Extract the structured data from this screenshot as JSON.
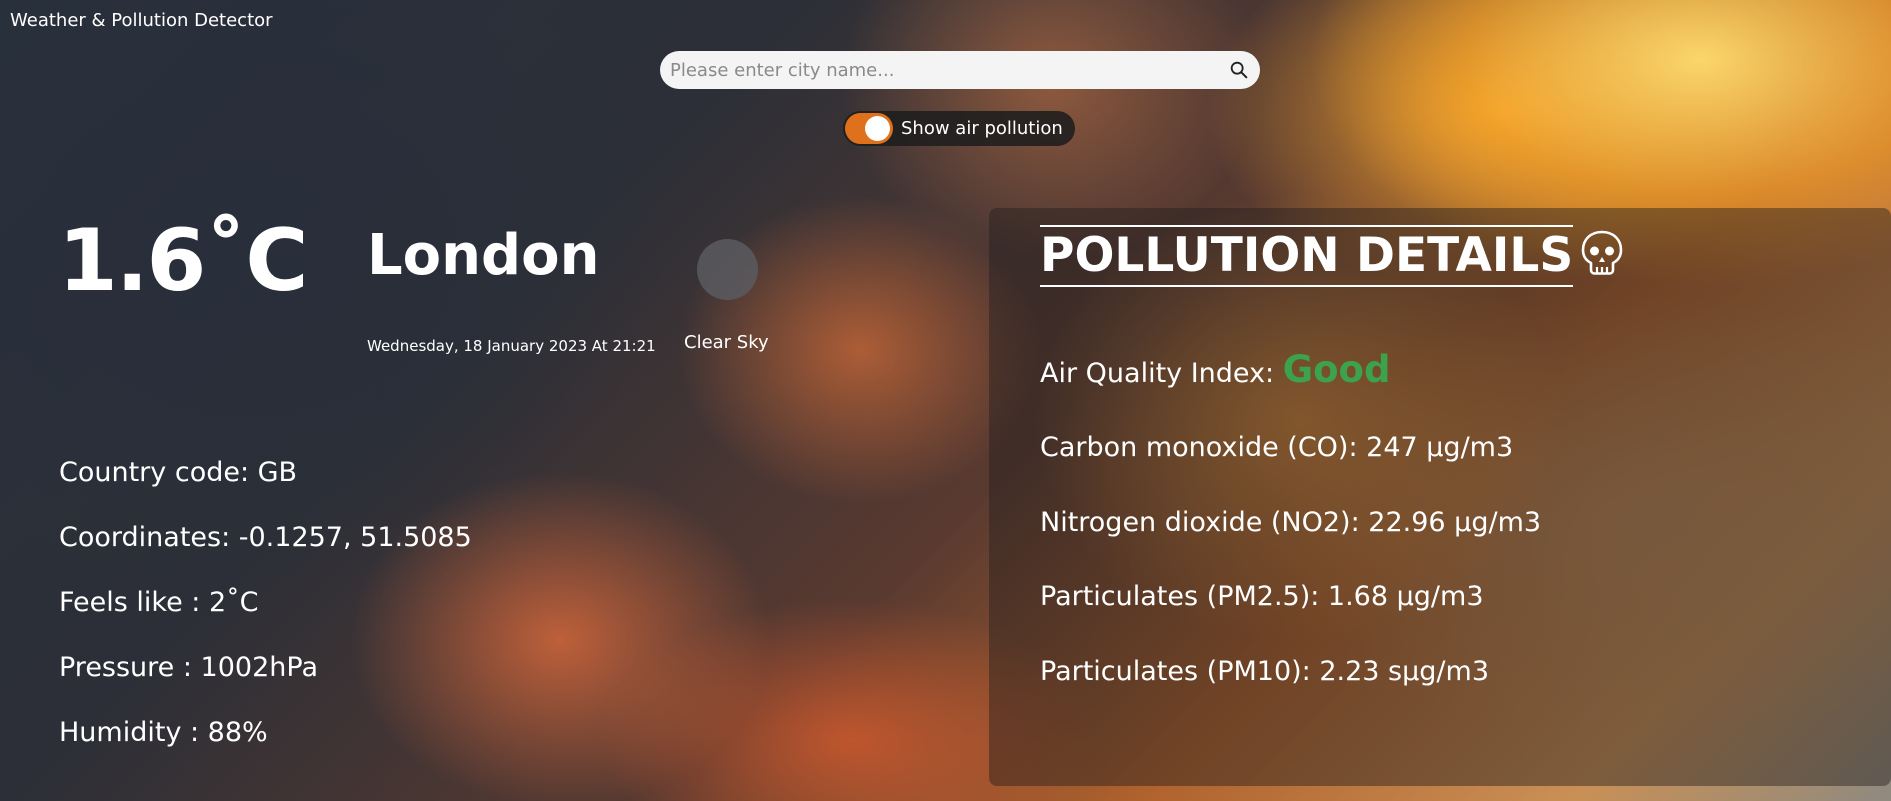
{
  "header": {
    "app_title": "Weather & Pollution Detector"
  },
  "search": {
    "placeholder": "Please enter city name...",
    "value": "",
    "icon": "search-icon"
  },
  "pollution_toggle": {
    "label": "Show air pollution",
    "enabled": true,
    "accent_color": "#e0711c"
  },
  "weather": {
    "temperature": "1.6˚C",
    "city": "London",
    "datetime": "Wednesday, 18 January 2023 At 21:21",
    "condition": "Clear Sky",
    "details": [
      {
        "label": "Country code: GB"
      },
      {
        "label": "Coordinates: -0.1257, 51.5085"
      },
      {
        "label": "Feels like : 2˚C"
      },
      {
        "label": "Pressure : 1002hPa"
      },
      {
        "label": "Humidity : 88%"
      }
    ]
  },
  "pollution": {
    "heading": "POLLUTION DETAILS",
    "icon": "skull-icon",
    "aqi_label": "Air Quality Index: ",
    "aqi_value": "Good",
    "aqi_color": "#3ca34c",
    "items": [
      {
        "label": "Carbon monoxide (CO): 247 µg/m3"
      },
      {
        "label": "Nitrogen dioxide (NO2): 22.96 µg/m3"
      },
      {
        "label": "Particulates (PM2.5): 1.68 µg/m3"
      },
      {
        "label": "Particulates (PM10): 2.23 sµg/m3"
      }
    ]
  }
}
